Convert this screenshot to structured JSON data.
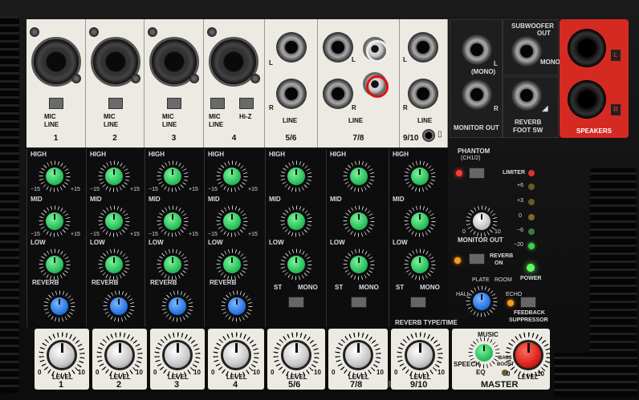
{
  "inputs": [
    {
      "number": "1",
      "mic": "MIC",
      "line": "LINE"
    },
    {
      "number": "2",
      "mic": "MIC",
      "line": "LINE"
    },
    {
      "number": "3",
      "mic": "MIC",
      "line": "LINE"
    },
    {
      "number": "4",
      "mic": "MIC",
      "line": "LINE",
      "hiz": "Hi-Z"
    },
    {
      "number": "5/6",
      "l": "L",
      "r": "R",
      "line": "LINE"
    },
    {
      "number": "7/8",
      "l": "L",
      "r": "R",
      "line": "LINE"
    },
    {
      "number": "9/10",
      "l": "L",
      "r": "R",
      "line": "LINE"
    }
  ],
  "outputs": {
    "mono": "(MONO)",
    "l": "L",
    "r": "R",
    "monitor_out": "MONITOR OUT",
    "subwoofer": "SUBWOOFER",
    "subwoofer_out": "OUT",
    "subwoofer_mono": "MONO",
    "reverb": "REVERB",
    "foot_sw": "FOOT SW",
    "speakers": "SPEAKERS",
    "spk_l": "L",
    "spk_r": "R"
  },
  "eq": {
    "high": "HIGH",
    "mid": "MID",
    "low": "LOW",
    "reverb": "REVERB",
    "min": "−15",
    "max": "+15",
    "zero": "0",
    "st": "ST",
    "mono": "MONO"
  },
  "right": {
    "phantom": "PHANTOM",
    "phantom_sub": "(CH1/2)",
    "limiter": "LIMITER",
    "meter": [
      "+6",
      "+3",
      "0",
      "−6",
      "−20"
    ],
    "monitor_out": "MONITOR OUT",
    "reverb_on": "REVERB",
    "reverb_on2": "ON",
    "power": "POWER",
    "reverb_type": "REVERB TYPE/TIME",
    "plate": "PLATE",
    "room": "ROOM",
    "hall": "HALL",
    "echo": "ECHO",
    "feedback": "FEEDBACK",
    "suppressor": "SUPPRESSOR",
    "scale_min": "0",
    "scale_max": "10"
  },
  "levels": {
    "label": "LEVEL",
    "min": "0",
    "max": "10",
    "channels": [
      "1",
      "2",
      "3",
      "4",
      "5/6",
      "7/8",
      "9/10"
    ],
    "music": "MUSIC",
    "speech": "SPEECH",
    "eq": "EQ",
    "bass": "BASS",
    "boost": "BOOST",
    "master": "MASTER"
  },
  "colors": {
    "accent_red": "#d42a22",
    "knob_green": "#21b856",
    "knob_blue": "#1e6ee0"
  }
}
